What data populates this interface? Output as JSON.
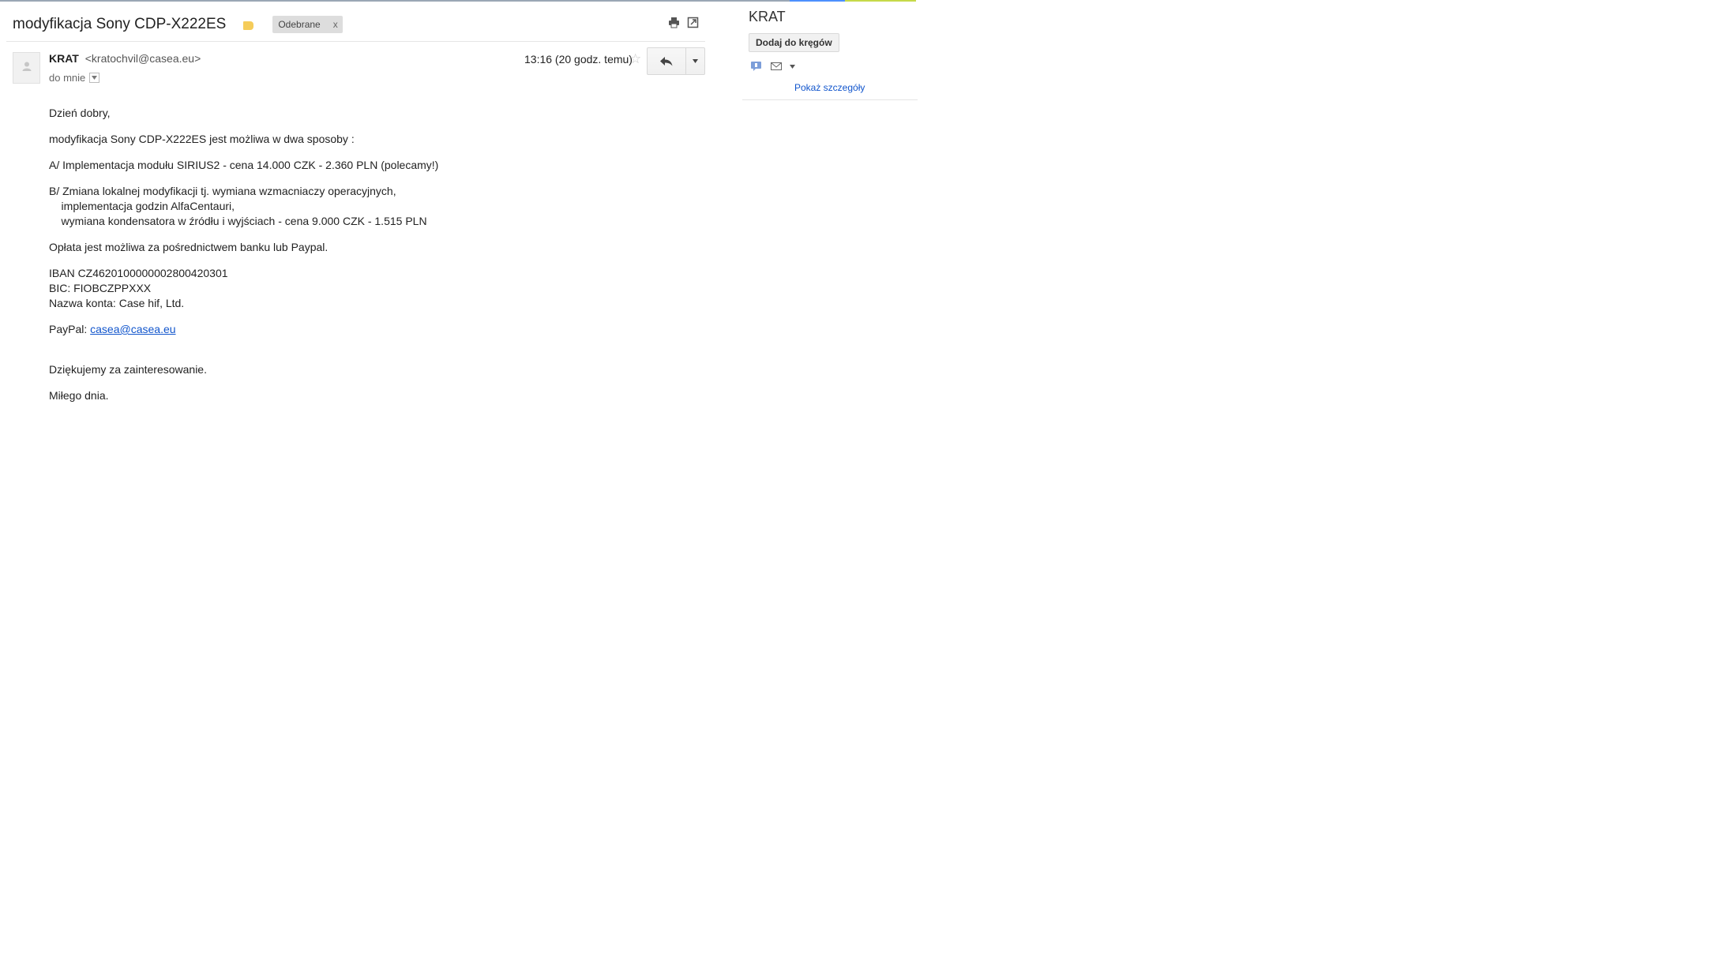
{
  "email": {
    "subject": "modyfikacja Sony CDP-X222ES",
    "label_chip": "Odebrane",
    "label_chip_remove": "x",
    "sender_name": "KRAT",
    "sender_email": "<kratochvil@casea.eu>",
    "recipient": "do mnie",
    "timestamp": "13:16 (20 godz. temu)",
    "body": {
      "greeting": "Dzień dobry,",
      "intro": "modyfikacja Sony CDP-X222ES jest możliwa w dwa sposoby :",
      "option_a": "A/ Implementacja modułu SIRIUS2 - cena 14.000 CZK - 2.360 PLN (polecamy!)",
      "option_b": "B/ Zmiana lokalnej modyfikacji tj. wymiana wzmacniaczy operacyjnych,\n    implementacja godzin AlfaCentauri,\n    wymiana kondensatora w źródłu i wyjściach - cena 9.000 CZK - 1.515 PLN",
      "payment": "Opłata jest możliwa za pośrednictwem banku lub Paypal.",
      "bank_details": "IBAN CZ4620100000002800420301\nBIC: FIOBCZPPXXX\nNazwa konta: Case hif, Ltd.",
      "paypal_label": "PayPal: ",
      "paypal_email": "casea@casea.eu",
      "thanks": "Dziękujemy za zainteresowanie.",
      "closing": "Miłego dnia."
    }
  },
  "sidebar": {
    "contact_name": "KRAT",
    "add_to_circles": "Dodaj do kręgów",
    "show_details": "Pokaż szczegóły"
  },
  "icons": {
    "label": "label-tag-icon",
    "print": "print-icon",
    "popout": "new-window-icon",
    "star": "star-icon",
    "reply": "reply-icon",
    "more": "dropdown-arrow-icon",
    "avatar": "person-icon",
    "chat": "chat-icon",
    "mail": "mail-icon"
  },
  "colors": {
    "link": "#1155cc",
    "label_yellow": "#f5cc5a",
    "chip_bg": "#dddddd"
  }
}
